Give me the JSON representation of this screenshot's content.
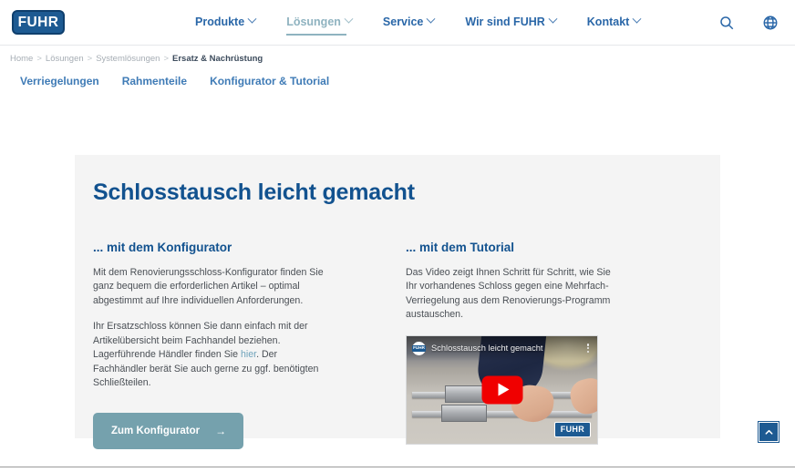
{
  "brand": {
    "name": "FUHR"
  },
  "header": {
    "nav": [
      {
        "label": "Produkte",
        "has_caret": true,
        "active": false
      },
      {
        "label": "Lösungen",
        "has_caret": true,
        "active": true
      },
      {
        "label": "Service",
        "has_caret": true,
        "active": false
      },
      {
        "label": "Wir sind FUHR",
        "has_caret": true,
        "active": false
      },
      {
        "label": "Kontakt",
        "has_caret": true,
        "active": false
      }
    ],
    "tools": [
      {
        "icon": "search-icon"
      },
      {
        "icon": "globe-icon"
      }
    ]
  },
  "breadcrumb": {
    "items": [
      "Home",
      "Lösungen",
      "Systemlösungen",
      "Ersatz & Nachrüstung"
    ],
    "separator": ">"
  },
  "subnav": {
    "items": [
      "Verriegelungen",
      "Rahmenteile",
      "Konfigurator & Tutorial"
    ]
  },
  "hero": {
    "title": "Schlosstausch leicht gemacht",
    "left": {
      "heading": "... mit dem Konfigurator",
      "paragraph1": "Mit dem Renovierungsschloss-Konfigurator finden Sie ganz bequem die erforderlichen Artikel – optimal abgestimmt auf Ihre individuellen Anforderungen.",
      "paragraph2_before": "Ihr Ersatzschloss können Sie dann einfach mit der Artikelübersicht beim Fachhandel beziehen. Lagerführende Händler finden Sie ",
      "paragraph2_link": "hier",
      "paragraph2_after": ". Der Fachhändler berät Sie auch gerne zu ggf. benötigten Schließteilen.",
      "button_label": "Zum Konfigurator",
      "button_arrow": "→"
    },
    "right": {
      "heading": "... mit dem Tutorial",
      "paragraph": "Das Video zeigt Ihnen Schritt für Schritt, wie Sie Ihr vorhandenes Schloss gegen eine Mehrfach-Verriegelung aus dem Renovierungs-Programm austauschen.",
      "video": {
        "title": "Schlosstausch leicht gemacht",
        "channel_badge": "FUHR",
        "watermark": "FUHR",
        "play_icon": "play-icon",
        "menu_icon": "kebab-menu-icon"
      }
    }
  },
  "scroll_top": {
    "icon": "chevron-up-icon"
  },
  "colors": {
    "brand_blue": "#1d5a92",
    "heading_blue": "#12528f",
    "nav_blue": "#2a67a8",
    "active_teal": "#8fb3c0",
    "button_teal": "#75a1ad",
    "panel_gray": "#f4f4f4",
    "body_text": "#4a4f55",
    "link_teal": "#6fa3bb",
    "youtube_red": "#f00000"
  }
}
